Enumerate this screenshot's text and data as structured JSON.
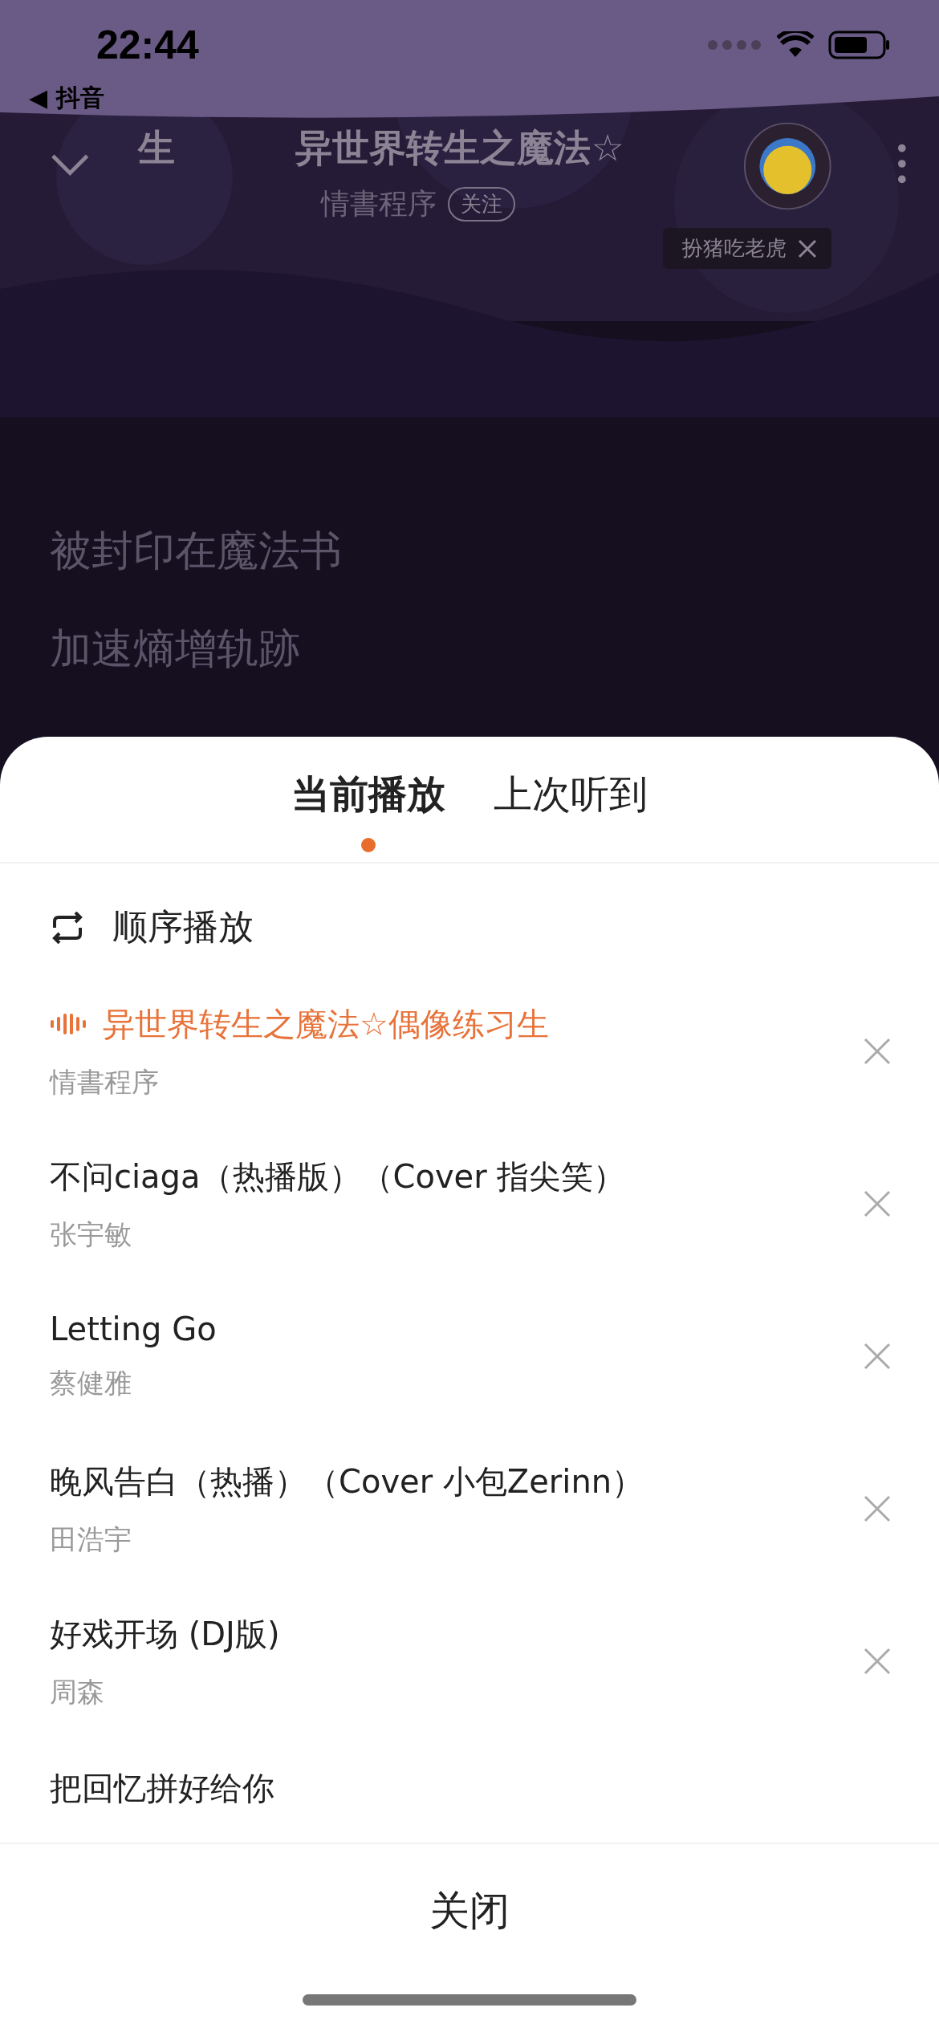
{
  "status_bar": {
    "time": "22:44",
    "back_app": "◀ 抖音"
  },
  "header": {
    "marquee": [
      "生",
      "异世界转生之魔法☆"
    ],
    "artist": "情書程序",
    "follow": "关注",
    "tooltip": "扮猪吃老虎"
  },
  "lyrics": [
    "被封印在魔法书",
    "加速熵增轨跡"
  ],
  "sheet": {
    "tabs": [
      {
        "label": "当前播放",
        "selected": true
      },
      {
        "label": "上次听到",
        "selected": false
      }
    ],
    "mode": "顺序播放",
    "songs": [
      {
        "title": "异世界转生之魔法☆偶像练习生",
        "artist": "情書程序",
        "playing": true
      },
      {
        "title": "不问ciaga（热播版）（Cover 指尖笑）",
        "artist": "张宇敏",
        "playing": false
      },
      {
        "title": "Letting Go",
        "artist": "蔡健雅",
        "playing": false
      },
      {
        "title": "晚风告白（热播）（Cover 小包Zerinn）",
        "artist": "田浩宇",
        "playing": false
      },
      {
        "title": "好戏开场 (DJ版)",
        "artist": "周森",
        "playing": false
      },
      {
        "title": "把回忆拼好给你",
        "playing": false
      }
    ],
    "close": "关闭"
  }
}
